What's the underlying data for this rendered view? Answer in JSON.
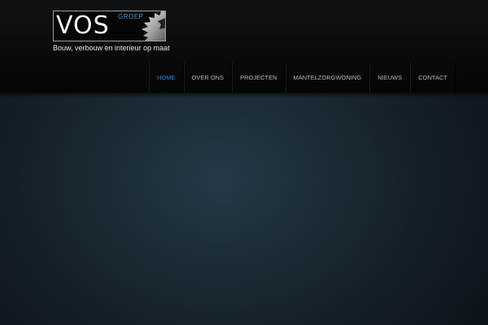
{
  "logo": {
    "name": "VOS",
    "sub": "GROEP",
    "tagline": "Bouw, verbouw en interieur op maat"
  },
  "nav": {
    "items": [
      {
        "label": "HOME",
        "active": true
      },
      {
        "label": "OVER ONS",
        "active": false
      },
      {
        "label": "PROJECTEN",
        "active": false
      },
      {
        "label": "MANTELZORGWONING",
        "active": false
      },
      {
        "label": "NIEUWS",
        "active": false
      },
      {
        "label": "CONTACT",
        "active": false
      }
    ]
  },
  "colors": {
    "accent": "#2a8ad6",
    "header": "#050505",
    "nav_text": "#b8b8b8",
    "logo_groep": "#3f97d8"
  },
  "icons": {
    "logo_mark": "saw-blade-icon"
  }
}
